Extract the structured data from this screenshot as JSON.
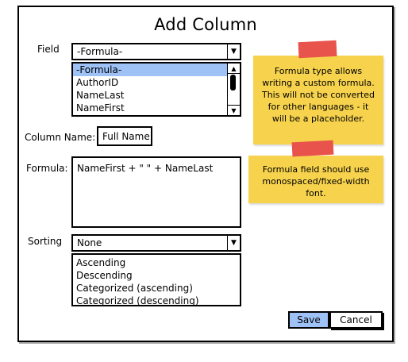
{
  "dialog": {
    "title": "Add Column"
  },
  "field": {
    "label": "Field",
    "value": "-Formula-",
    "options": [
      "-Formula-",
      "AuthorID",
      "NameLast",
      "NameFirst"
    ],
    "selected_index": 0
  },
  "column_name": {
    "label": "Column Name:",
    "value": "Full Name"
  },
  "formula": {
    "label": "Formula:",
    "value": "NameFirst + \" \" + NameLast"
  },
  "sorting": {
    "label": "Sorting",
    "value": "None",
    "options": [
      "Ascending",
      "Descending",
      "Categorized (ascending)",
      "Categorized (descending)"
    ]
  },
  "buttons": {
    "save_label": "Save",
    "cancel_label": "Cancel"
  },
  "notes": {
    "note1": "Formula type allows writing a custom formula.  This will not be converted for other languages - it will be a placeholder.",
    "note2": "Formula field should use monospaced/fixed-width font."
  },
  "colors": {
    "selection": "#9ec2f6",
    "note_background": "#f7d34d",
    "note_tape": "#e8534b",
    "save_button": "#9ec2f6"
  }
}
